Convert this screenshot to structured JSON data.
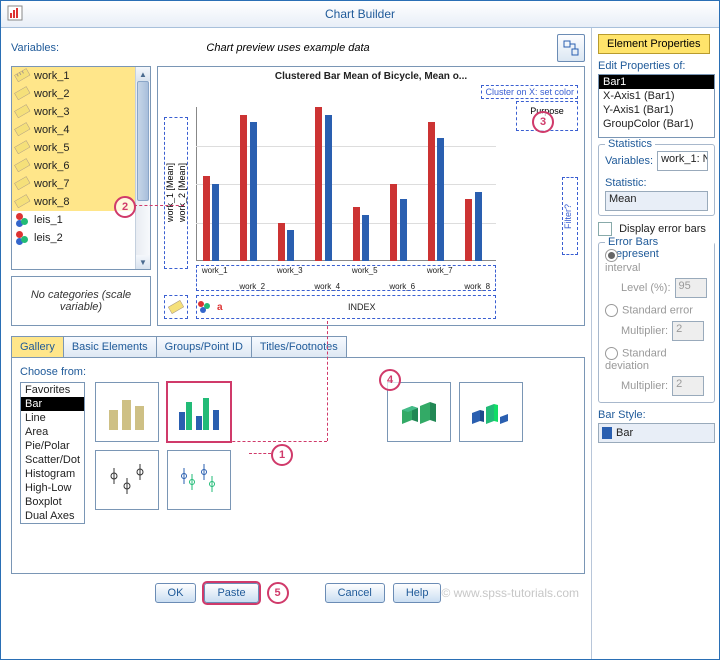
{
  "window": {
    "title": "Chart Builder"
  },
  "left": {
    "variables_label": "Variables:",
    "preview_label": "Chart preview uses example data",
    "vars": [
      "work_1",
      "work_2",
      "work_3",
      "work_4",
      "work_5",
      "work_6",
      "work_7",
      "work_8",
      "leis_1",
      "leis_2"
    ],
    "nocat": "No categories (scale variable)"
  },
  "preview": {
    "title": "Clustered Bar Mean of Bicycle, Mean o...",
    "legend_title": "Cluster on X: set color",
    "legend_item": "Purpose",
    "filter": "Filter?",
    "yaxis1": "work_1 [Mean]",
    "yaxis2": "work_2 [Mean]",
    "index_label": "INDEX",
    "xcats_top": [
      "work_1",
      "work_3",
      "work_5",
      "work_7"
    ],
    "xcats_bot": [
      "work_2",
      "work_4",
      "work_6",
      "work_8"
    ]
  },
  "tabs": {
    "gallery": "Gallery",
    "basic": "Basic Elements",
    "groups": "Groups/Point ID",
    "titles": "Titles/Footnotes"
  },
  "gallery": {
    "choose_label": "Choose from:",
    "items": [
      "Favorites",
      "Bar",
      "Line",
      "Area",
      "Pie/Polar",
      "Scatter/Dot",
      "Histogram",
      "High-Low",
      "Boxplot",
      "Dual Axes"
    ]
  },
  "buttons": {
    "ok": "OK",
    "paste": "Paste",
    "cancel": "Cancel",
    "help": "Help"
  },
  "markers": {
    "m1": "1",
    "m2": "2",
    "m3": "3",
    "m4": "4",
    "m5": "5"
  },
  "watermark": "© www.spss-tutorials.com",
  "right": {
    "ep_btn": "Element Properties",
    "edit_label": "Edit Properties of:",
    "items": [
      "Bar1",
      "X-Axis1 (Bar1)",
      "Y-Axis1 (Bar1)",
      "GroupColor (Bar1)"
    ],
    "stats_title": "Statistics",
    "vars_label": "Variables:",
    "var_value": "work_1: N",
    "stat_label": "Statistic:",
    "stat_value": "Mean",
    "display_err": "Display error bars",
    "err_title": "Error Bars Represent",
    "ci": "Confidence interval",
    "level": "Level (%):",
    "level_v": "95",
    "se": "Standard error",
    "mult": "Multiplier:",
    "mult_v": "2",
    "sd": "Standard deviation",
    "barstyle_label": "Bar Style:",
    "barstyle_value": "Bar"
  },
  "chart_data": {
    "type": "bar",
    "title": "Clustered Bar Mean of Bicycle, Mean o...",
    "categories": [
      "work_1",
      "work_2",
      "work_3",
      "work_4",
      "work_5",
      "work_6",
      "work_7",
      "work_8"
    ],
    "series": [
      {
        "name": "work_1 [Mean]",
        "values": [
          55,
          95,
          25,
          100,
          35,
          50,
          90,
          40
        ]
      },
      {
        "name": "work_2 [Mean]",
        "values": [
          50,
          90,
          20,
          95,
          30,
          40,
          80,
          45
        ]
      }
    ],
    "xlabel": "INDEX",
    "ylabel": "Mean",
    "ylim": [
      0,
      100
    ],
    "legend_position": "right",
    "cluster_on_x": "Purpose"
  }
}
